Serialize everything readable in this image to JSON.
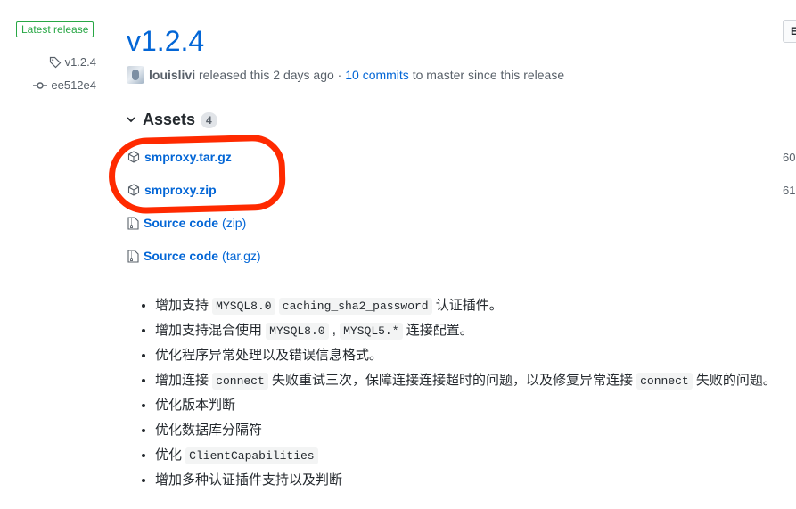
{
  "sidebar": {
    "badge": "Latest release",
    "tag": "v1.2.4",
    "commit": "ee512e4",
    "tag_icon": "tag-icon",
    "commit_icon": "git-commit-icon"
  },
  "release": {
    "title": "v1.2.4",
    "top_right_button": "E",
    "author": "louislivi",
    "released_text": " released this 2 days ago · ",
    "commits_link": "10 commits",
    "commits_suffix": " to master since this release"
  },
  "assets": {
    "header": "Assets",
    "count": "4",
    "items": [
      {
        "name": "smproxy.tar.gz",
        "sub": "",
        "size": "60",
        "icon": "package-icon"
      },
      {
        "name": "smproxy.zip",
        "sub": "",
        "size": "61",
        "icon": "package-icon"
      },
      {
        "name": "Source code",
        "sub": "(zip)",
        "size": "",
        "icon": "file-zip-icon"
      },
      {
        "name": "Source code",
        "sub": "(tar.gz)",
        "size": "",
        "icon": "file-zip-icon"
      }
    ]
  },
  "annotation_color": "#ff2a00",
  "notes": [
    {
      "segments": [
        {
          "t": "增加支持 "
        },
        {
          "c": "MYSQL8.0"
        },
        {
          "t": " "
        },
        {
          "c": "caching_sha2_password"
        },
        {
          "t": " 认证插件。"
        }
      ]
    },
    {
      "segments": [
        {
          "t": "增加支持混合使用 "
        },
        {
          "c": "MYSQL8.0"
        },
        {
          "t": " , "
        },
        {
          "c": "MYSQL5.*"
        },
        {
          "t": " 连接配置。"
        }
      ]
    },
    {
      "segments": [
        {
          "t": "优化程序异常处理以及错误信息格式。"
        }
      ]
    },
    {
      "segments": [
        {
          "t": "增加连接 "
        },
        {
          "c": "connect"
        },
        {
          "t": " 失败重试三次，保障连接连接超时的问题，以及修复异常连接 "
        },
        {
          "c": "connect"
        },
        {
          "t": " 失败的问题。"
        }
      ]
    },
    {
      "segments": [
        {
          "t": "优化版本判断"
        }
      ]
    },
    {
      "segments": [
        {
          "t": "优化数据库分隔符"
        }
      ]
    },
    {
      "segments": [
        {
          "t": "优化 "
        },
        {
          "c": "ClientCapabilities"
        }
      ]
    },
    {
      "segments": [
        {
          "t": "增加多种认证插件支持以及判断"
        }
      ]
    }
  ]
}
